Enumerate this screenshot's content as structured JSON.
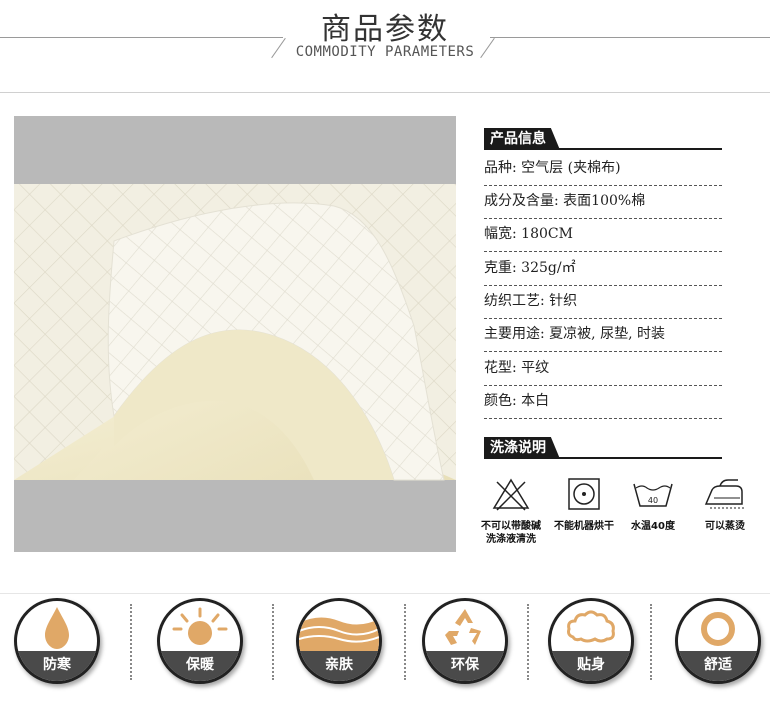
{
  "header": {
    "title": "商品参数",
    "subtitle": "COMMODITY PARAMETERS"
  },
  "product_info": {
    "heading": "产品信息",
    "rows": [
      "品种: 空气层 (夹棉布)",
      "成分及含量: 表面100%棉",
      "幅宽: 180CM",
      "克重: 325g/㎡",
      "纺织工艺: 针织",
      "主要用途: 夏凉被, 尿垫, 时装",
      "花型: 平纹",
      "颜色: 本白"
    ]
  },
  "washing": {
    "heading": "洗涤说明",
    "items": [
      {
        "icon": "no-bleach-icon",
        "label_line1": "不可以带酸碱",
        "label_line2": "洗涤液清洗"
      },
      {
        "icon": "no-tumble-dry-icon",
        "label_line1": "不能机器烘干",
        "label_line2": ""
      },
      {
        "icon": "wash-40-icon",
        "label_line1": "水温40度",
        "label_line2": "",
        "temp": "40"
      },
      {
        "icon": "steam-iron-icon",
        "label_line1": "可以蒸烫",
        "label_line2": ""
      }
    ]
  },
  "features": [
    {
      "icon": "water-drop-icon",
      "label": "防寒"
    },
    {
      "icon": "sun-icon",
      "label": "保暖"
    },
    {
      "icon": "fabric-layers-icon",
      "label": "亲肤"
    },
    {
      "icon": "recycle-icon",
      "label": "环保"
    },
    {
      "icon": "cloud-icon",
      "label": "贴身"
    },
    {
      "icon": "ring-icon",
      "label": "舒适"
    }
  ],
  "colors": {
    "accent": "#e0a867",
    "dark": "#1a1a1a",
    "feature_band": "#4a4a4a",
    "photo_bg": "#b9b9b9",
    "fabric": "#f3f0e3"
  }
}
